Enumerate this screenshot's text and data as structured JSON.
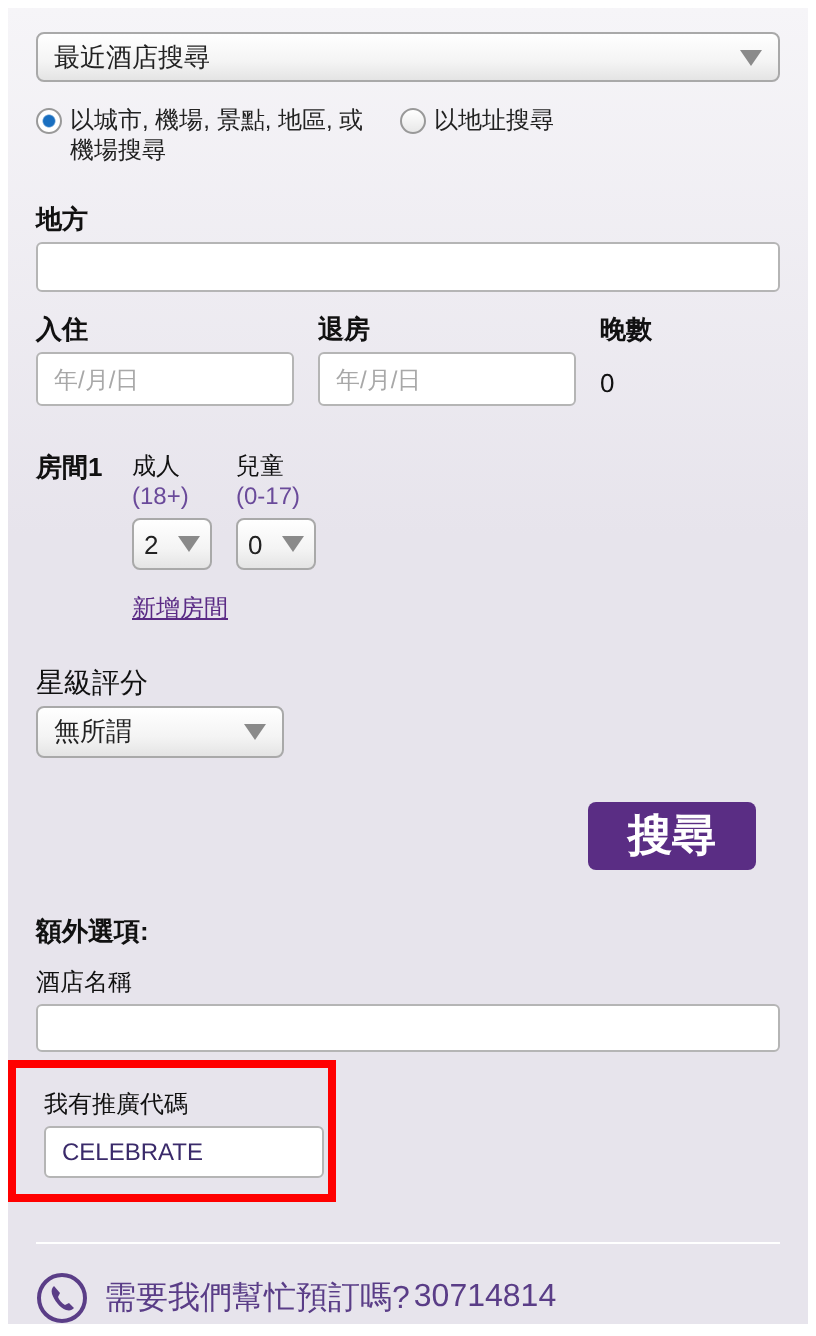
{
  "recent_search": {
    "value": "最近酒店搜尋"
  },
  "search_modes": [
    {
      "label": "以城市, 機場, 景點, 地區, 或機場搜尋",
      "selected": true
    },
    {
      "label": "以地址搜尋",
      "selected": false
    }
  ],
  "destination": {
    "label": "地方"
  },
  "check_in": {
    "label": "入住",
    "placeholder": "年/月/日"
  },
  "check_out": {
    "label": "退房",
    "placeholder": "年/月/日"
  },
  "nights": {
    "label": "晚數",
    "value": "0"
  },
  "rooms": [
    {
      "label": "房間1",
      "adults": {
        "label": "成人",
        "range": "(18+)",
        "value": "2"
      },
      "children": {
        "label": "兒童",
        "range": "(0-17)",
        "value": "0"
      }
    }
  ],
  "add_room": "新增房間",
  "star_rating": {
    "label": "星級評分",
    "value": "無所謂"
  },
  "search_button": "搜尋",
  "extras": {
    "title": "額外選項:",
    "hotel_name": {
      "label": "酒店名稱"
    },
    "promo_code": {
      "label": "我有推廣代碼",
      "value": "CELEBRATE",
      "highlighted": true
    }
  },
  "help": {
    "text": "需要我們幫忙預訂嗎?",
    "phone": "30714814"
  }
}
